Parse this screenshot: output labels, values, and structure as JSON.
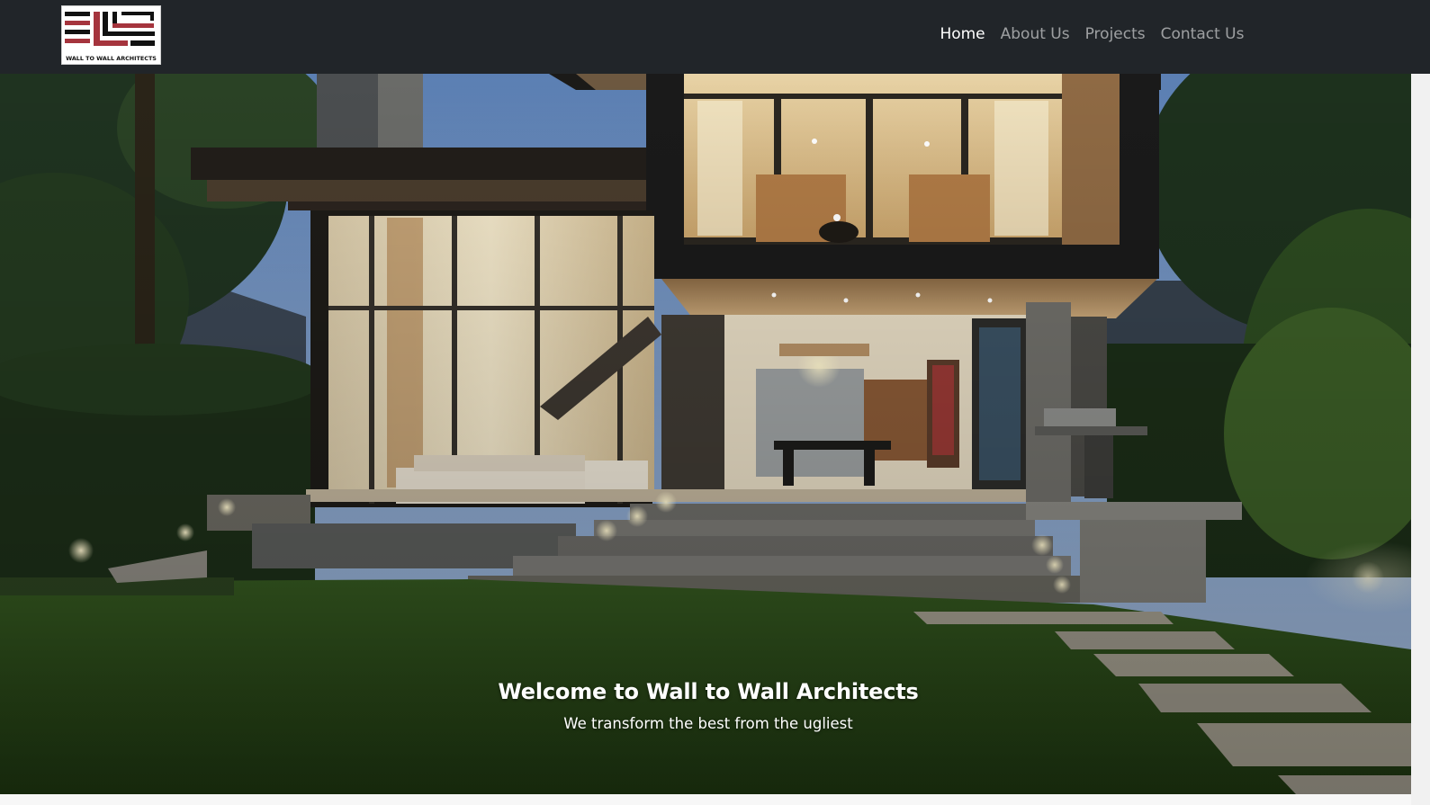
{
  "brand": {
    "logo_text": "WALL TO WALL ARCHITECTS",
    "logo_icon": "wall-to-wall-logo",
    "logo_colors": {
      "black": "#111111",
      "red": "#a5343d",
      "white": "#ffffff"
    }
  },
  "nav": {
    "items": [
      {
        "label": "Home",
        "active": true
      },
      {
        "label": "About Us",
        "active": false
      },
      {
        "label": "Projects",
        "active": false
      },
      {
        "label": "Contact Us",
        "active": false
      }
    ]
  },
  "hero": {
    "image": "modern-house-night-photo",
    "title": "Welcome to Wall to Wall Architects",
    "subtitle": "We transform the best from the ugliest"
  },
  "colors": {
    "navbar_bg": "#212529",
    "nav_active": "#ffffff",
    "nav_inactive": "rgba(255,255,255,0.56)"
  }
}
